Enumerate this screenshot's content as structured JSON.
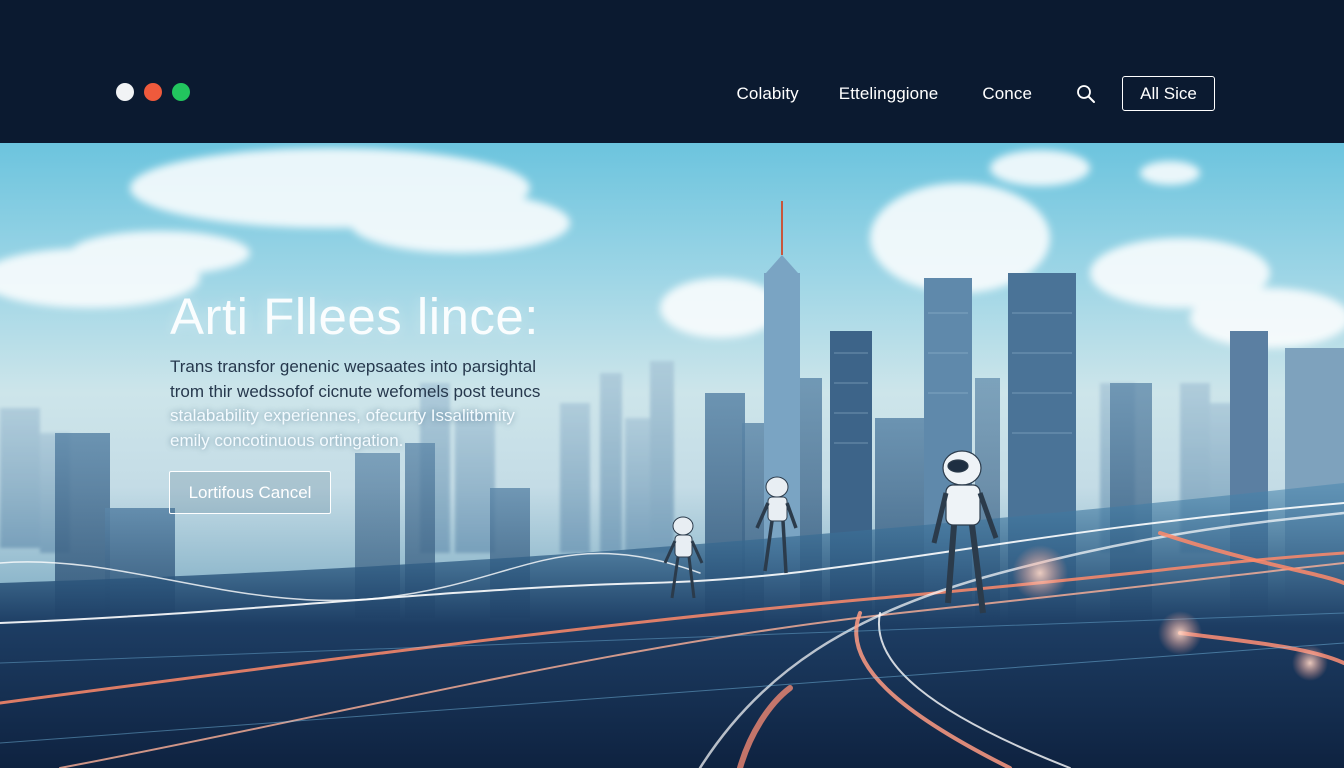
{
  "window_controls": [
    {
      "name": "white",
      "color": "#f1f3f5"
    },
    {
      "name": "red",
      "color": "#ef5a3c"
    },
    {
      "name": "green",
      "color": "#22c55e"
    }
  ],
  "nav": {
    "links": [
      "Colabity",
      "Ettelinggione",
      "Conce"
    ],
    "search_icon": "search-icon",
    "button_label": "All Sice"
  },
  "hero": {
    "title": "Arti Fllees lince:",
    "description_lines": [
      "Trans transfor genenic wepsaates into parsightal",
      "trom thir wedssofof cicnute wefomels post teuncs",
      "stalabability experiennes, ofecurty Issalitbmity",
      "emily concotinuous ortingation."
    ],
    "cta_label": "Lortifous Cancel"
  }
}
